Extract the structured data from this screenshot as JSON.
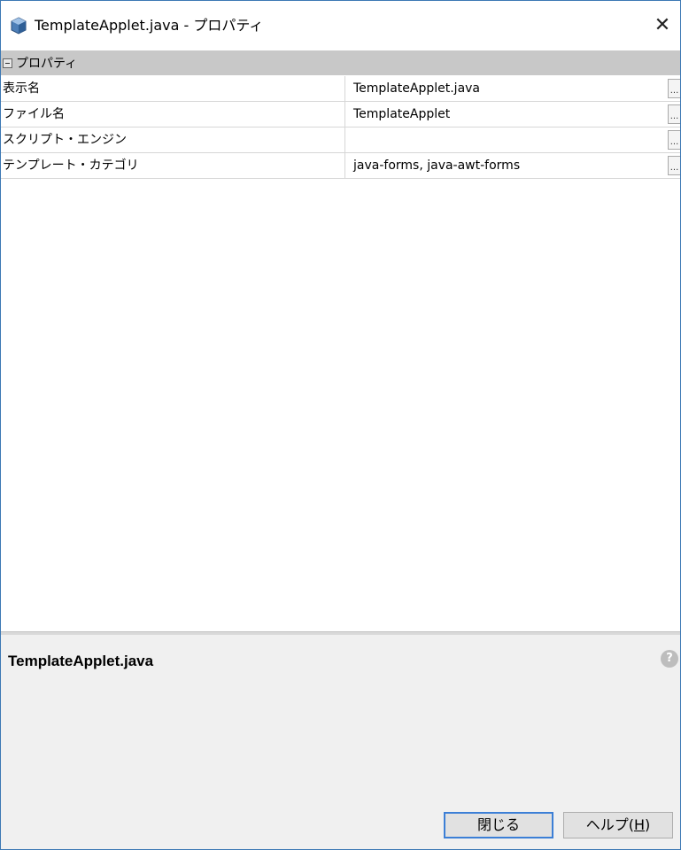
{
  "window": {
    "title": "TemplateApplet.java - プロパティ",
    "close_glyph": "✕",
    "icon": "java-file-cube-icon"
  },
  "property_sheet": {
    "category": "プロパティ",
    "rows": [
      {
        "name": "表示名",
        "value": "TemplateApplet.java",
        "button": "..."
      },
      {
        "name": "ファイル名",
        "value": "TemplateApplet",
        "button": "..."
      },
      {
        "name": "スクリプト・エンジン",
        "value": "",
        "button": "..."
      },
      {
        "name": "テンプレート・カテゴリ",
        "value": "java-forms, java-awt-forms",
        "button": "..."
      }
    ]
  },
  "description": {
    "title": "TemplateApplet.java",
    "help_icon": "help-icon"
  },
  "buttons": {
    "close_label": "閉じる",
    "help_label_prefix": "ヘルプ(",
    "help_mnemonic": "H",
    "help_label_suffix": ")"
  },
  "colors": {
    "window_border": "#3c78b4",
    "category_bg": "#c8c8c8",
    "default_button_border": "#3c7fd6",
    "panel_bg": "#f0f0f0"
  }
}
